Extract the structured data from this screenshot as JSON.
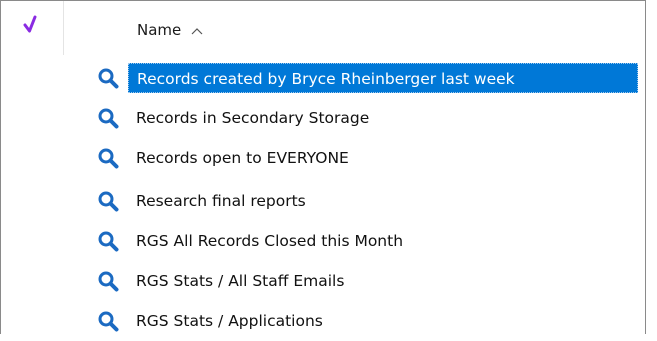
{
  "header": {
    "check_symbol": "✓",
    "name_column_label": "Name",
    "sort_direction": "ascending",
    "check_color": "#8a2be2"
  },
  "accent_color": "#0078d7",
  "search_icon_color": "#1b6ac2",
  "rows": [
    {
      "label": "Records created by Bryce Rheinberger last week",
      "icon": "search-icon",
      "selected": true
    },
    {
      "label": "Records in Secondary Storage",
      "icon": "search-icon",
      "selected": false
    },
    {
      "label": "Records open to EVERYONE",
      "icon": "search-icon",
      "selected": false
    },
    {
      "label": "Research final reports",
      "icon": "search-icon",
      "selected": false
    },
    {
      "label": "RGS All Records Closed this Month",
      "icon": "search-icon",
      "selected": false
    },
    {
      "label": "RGS Stats / All Staff Emails",
      "icon": "search-icon",
      "selected": false
    },
    {
      "label": "RGS Stats / Applications",
      "icon": "search-icon",
      "selected": false
    }
  ]
}
